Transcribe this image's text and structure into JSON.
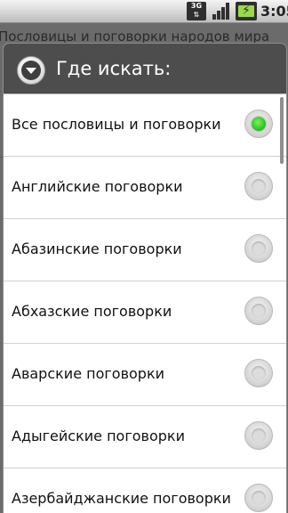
{
  "status_bar": {
    "network_label": "3G",
    "time": "3:05",
    "icons": [
      "3g-data-icon",
      "signal-strength-icon",
      "battery-charging-icon"
    ]
  },
  "background_app": {
    "title": "Пословицы и поговорки народов мира"
  },
  "dialog": {
    "title": "Где искать:",
    "icon": "chevron-down-icon",
    "options": [
      {
        "label": "Все пословицы и поговорки",
        "selected": true
      },
      {
        "label": "Английские поговорки",
        "selected": false
      },
      {
        "label": "Абазинские поговорки",
        "selected": false
      },
      {
        "label": "Абхазские поговорки",
        "selected": false
      },
      {
        "label": "Аварские поговорки",
        "selected": false
      },
      {
        "label": "Адыгейские поговорки",
        "selected": false
      },
      {
        "label": "Азербайджанские поговорки",
        "selected": false
      }
    ]
  },
  "colors": {
    "dialog_header": "#4d4d4d",
    "radio_selected": "#20c020",
    "dim_background": "#6b6b6b"
  }
}
